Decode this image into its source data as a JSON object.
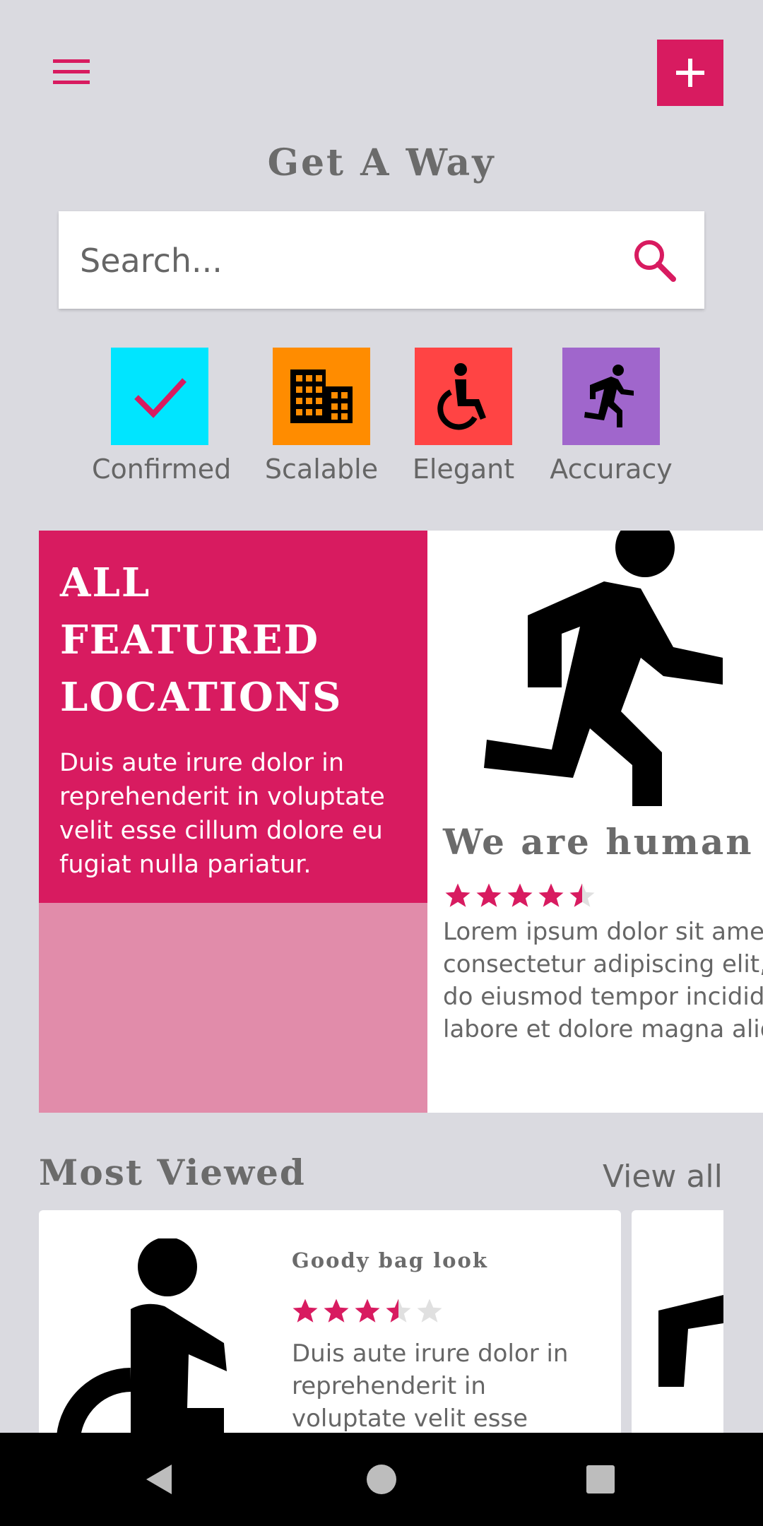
{
  "header": {
    "menu_icon": "hamburger-menu-icon",
    "add_icon": "plus-icon",
    "title": "Get A Way"
  },
  "search": {
    "placeholder": "Search...",
    "value": "",
    "icon": "search-icon"
  },
  "categories": [
    {
      "label": "Confirmed",
      "icon": "check-icon",
      "color": "#00e5ff"
    },
    {
      "label": "Scalable",
      "icon": "building-icon",
      "color": "#ff8c00"
    },
    {
      "label": "Elegant",
      "icon": "wheelchair-icon",
      "color": "#ff4444"
    },
    {
      "label": "Accuracy",
      "icon": "running-person-icon",
      "color": "#a066cc"
    }
  ],
  "featured": {
    "title_lines": [
      "ALL",
      "FEATURED",
      "LOCATIONS"
    ],
    "description": "Duis aute irure dolor in reprehenderit in voluptate velit esse cillum dolore eu fugiat nulla pariatur.",
    "color": "#d81b60",
    "secondary_color": "#e18caa"
  },
  "human_card": {
    "icon": "running-person-icon",
    "title": "We are human",
    "rating": 4.5,
    "description": "Lorem ipsum dolor sit amet, consectetur adipiscing elit, sed do eiusmod tempor incididunt ut labore et dolore magna aliqua."
  },
  "most_viewed": {
    "title": "Most Viewed",
    "view_all_label": "View all",
    "items": [
      {
        "icon": "seated-person-icon",
        "title": "Goody bag look",
        "rating": 3.5,
        "description": "Duis aute irure dolor in reprehenderit in voluptate velit esse"
      }
    ]
  },
  "navbar": {
    "back_icon": "back-triangle-icon",
    "home_icon": "home-circle-icon",
    "recents_icon": "recents-square-icon"
  },
  "colors": {
    "accent": "#d81b60",
    "background": "#dadae0",
    "star_empty": "#e0e0e0"
  }
}
